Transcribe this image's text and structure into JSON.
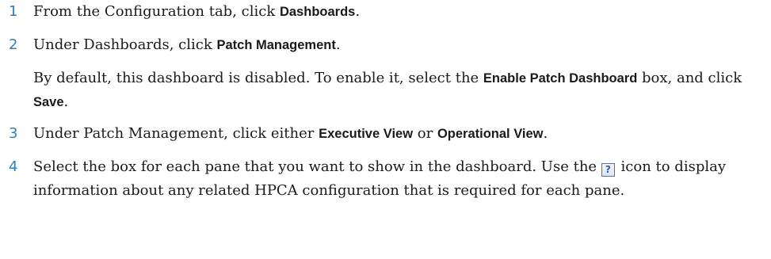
{
  "steps": [
    {
      "number": "1",
      "text_before": "From the Configuration tab, click ",
      "ui_term": "Dashboards",
      "text_after": "."
    },
    {
      "number": "2",
      "text_before": "Under Dashboards, click ",
      "ui_term": "Patch Management",
      "text_after": "."
    },
    {
      "note_before": "By default, this dashboard is disabled. To enable it, select the ",
      "note_ui_term_1": "Enable Patch Dashboard",
      "note_middle": " box, and click ",
      "note_ui_term_2": "Save",
      "note_after": "."
    },
    {
      "number": "3",
      "text_before": "Under Patch Management, click either ",
      "ui_term_1": "Executive View",
      "text_middle": " or ",
      "ui_term_2": "Operational View",
      "text_after": "."
    },
    {
      "number": "4",
      "text_before": "Select the box for each pane that you want to show in the dashboard. Use the ",
      "icon": "help-icon",
      "icon_glyph": "?",
      "text_after": " icon to display information about any related HPCA configuration that is required for each pane."
    }
  ],
  "colors": {
    "step_number": "#2b7fc0",
    "body_text": "#1a1a1a",
    "icon_border": "#5f6f86",
    "icon_glyph": "#1e5fbf"
  }
}
